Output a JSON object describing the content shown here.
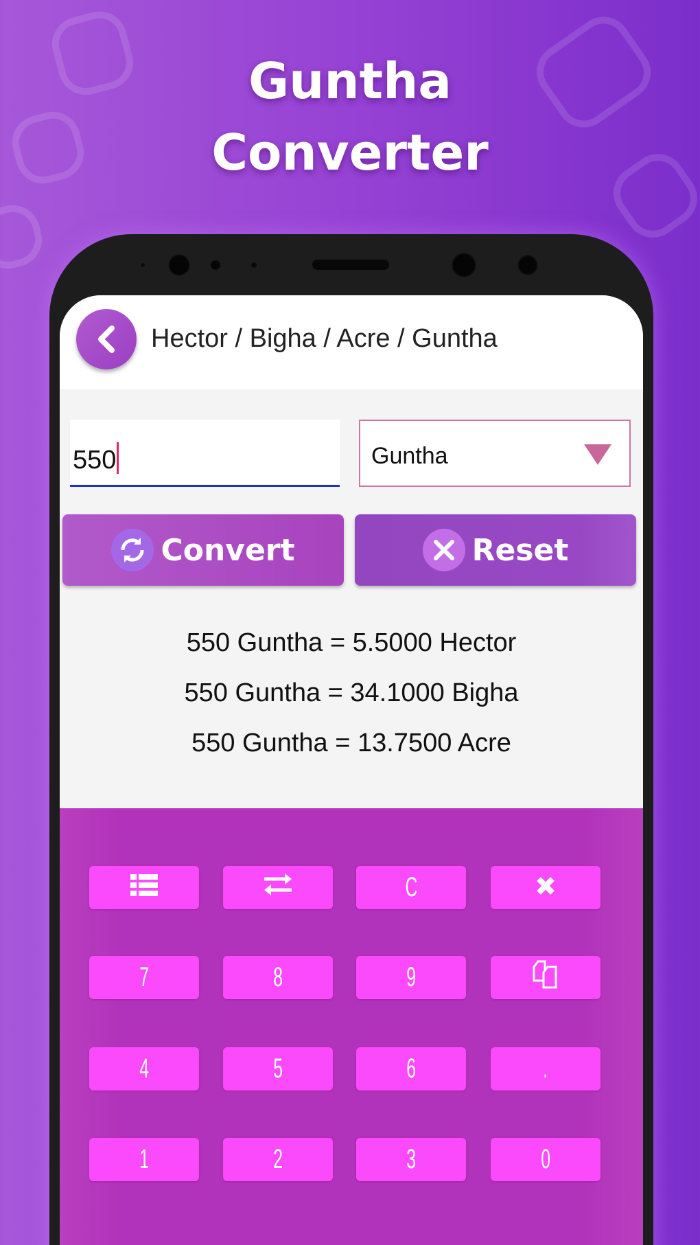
{
  "promo": {
    "title_line1": "Guntha",
    "title_line2": "Converter"
  },
  "header": {
    "title": "Hector / Bigha / Acre / Guntha",
    "back_icon": "chevron-left-icon"
  },
  "input": {
    "value": "550"
  },
  "unit_select": {
    "selected": "Guntha"
  },
  "buttons": {
    "convert": "Convert",
    "reset": "Reset"
  },
  "results": [
    "550 Guntha = 5.5000 Hector",
    "550 Guntha = 34.1000 Bigha",
    "550 Guntha = 13.7500 Acre"
  ],
  "keypad": {
    "keys": [
      {
        "label": "",
        "icon": "list-icon"
      },
      {
        "label": "",
        "icon": "swap-icon"
      },
      {
        "label": "C"
      },
      {
        "label": "",
        "icon": "close-icon"
      },
      {
        "label": "7"
      },
      {
        "label": "8"
      },
      {
        "label": "9"
      },
      {
        "label": "",
        "icon": "copy-icon"
      },
      {
        "label": "4"
      },
      {
        "label": "5"
      },
      {
        "label": "6"
      },
      {
        "label": "."
      },
      {
        "label": "1"
      },
      {
        "label": "2"
      },
      {
        "label": "3"
      },
      {
        "label": "0"
      }
    ]
  },
  "colors": {
    "accent": "#9b3fc4",
    "key": "#fb4afb",
    "keypad_bg": "#b233bb"
  }
}
